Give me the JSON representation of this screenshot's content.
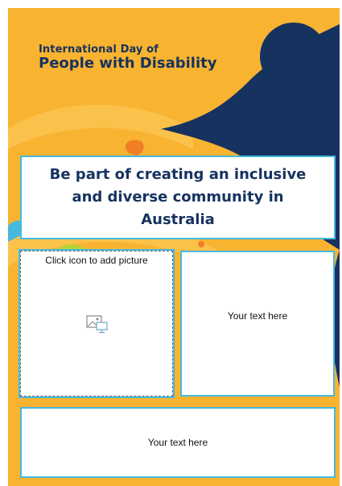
{
  "poster": {
    "title_line1": "International Day of",
    "title_line2": "People with Disability",
    "headline": "Be part of creating an inclusive and diverse community in Australia",
    "picture_placeholder": {
      "label": "Click icon to add picture",
      "icon": "insert-picture-icon"
    },
    "text_right": "Your text here",
    "text_bottom": "Your text here"
  },
  "colors": {
    "background": "#F8B331",
    "navy": "#16325F",
    "accent_blue": "#46B9DE",
    "accent_orange": "#F07E26",
    "accent_green": "#B9D336"
  }
}
